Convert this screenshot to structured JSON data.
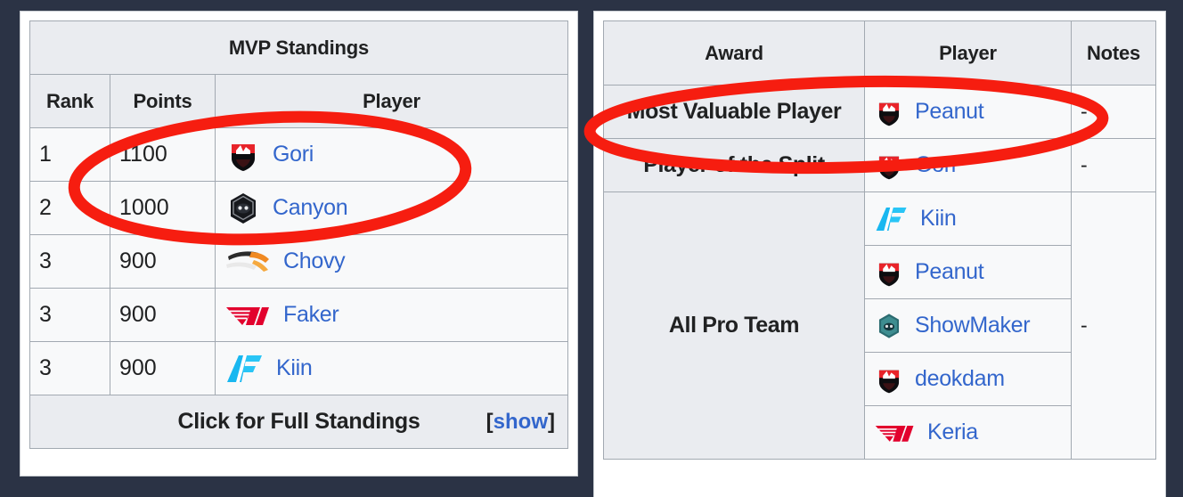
{
  "background_color": "#2b3345",
  "link_color": "#3366cc",
  "annotation_color": "#f61d10",
  "left_panel": {
    "title": "MVP Standings",
    "columns": [
      "Rank",
      "Points",
      "Player"
    ],
    "rows": [
      {
        "rank": "1",
        "points": "1100",
        "player": "Gori",
        "team_logo": "hle-shield-icon"
      },
      {
        "rank": "2",
        "points": "1000",
        "player": "Canyon",
        "team_logo": "geng-hex-icon"
      },
      {
        "rank": "3",
        "points": "900",
        "player": "Chovy",
        "team_logo": "swoosh-icon"
      },
      {
        "rank": "3",
        "points": "900",
        "player": "Faker",
        "team_logo": "t1-icon"
      },
      {
        "rank": "3",
        "points": "900",
        "player": "Kiin",
        "team_logo": "af-icon"
      }
    ],
    "footer_label": "Click for Full Standings",
    "footer_toggle_open": "[",
    "footer_toggle_link": "show",
    "footer_toggle_close": "]"
  },
  "right_panel": {
    "columns": [
      "Award",
      "Player",
      "Notes"
    ],
    "awards": [
      {
        "award": "Most Valuable Player",
        "notes": "-",
        "players": [
          {
            "name": "Peanut",
            "team_logo": "hle-shield-icon"
          }
        ]
      },
      {
        "award": "Player of the Split",
        "notes": "-",
        "players": [
          {
            "name": "Gori",
            "team_logo": "hle-shield-icon"
          }
        ]
      },
      {
        "award": "All Pro Team",
        "notes": "-",
        "players": [
          {
            "name": "Kiin",
            "team_logo": "af-icon"
          },
          {
            "name": "Peanut",
            "team_logo": "hle-shield-icon"
          },
          {
            "name": "ShowMaker",
            "team_logo": "dk-hex-icon"
          },
          {
            "name": "deokdam",
            "team_logo": "hle-shield-icon"
          },
          {
            "name": "Keria",
            "team_logo": "t1-icon"
          }
        ]
      }
    ]
  },
  "annotations": [
    {
      "name": "highlight-ellipse-gori",
      "shape": "ellipse"
    },
    {
      "name": "highlight-ellipse-peanut",
      "shape": "ellipse"
    }
  ]
}
